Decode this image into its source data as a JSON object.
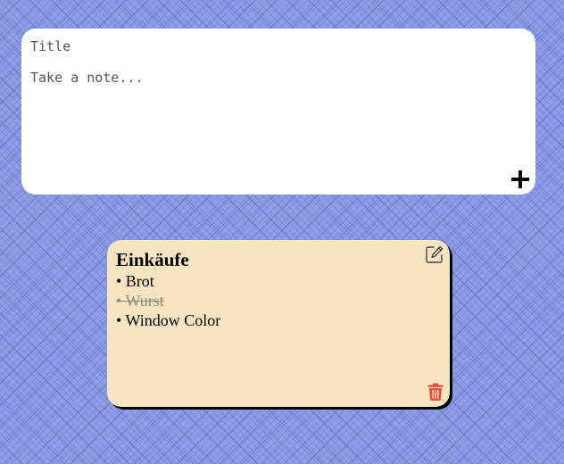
{
  "composer": {
    "title_placeholder": "Title",
    "title_value": "",
    "body_placeholder": "Take a note...",
    "body_value": "",
    "add_icon": "plus-icon"
  },
  "note": {
    "title": "Einkäufe",
    "background": "#f7e4c1",
    "items": [
      {
        "text": "• Brot",
        "done": false
      },
      {
        "text": "• Wurst",
        "done": true
      },
      {
        "text": "• Window Color",
        "done": false
      }
    ],
    "edit_icon": "edit-icon",
    "delete_icon": "trash-icon",
    "delete_color": "#e5503f"
  }
}
